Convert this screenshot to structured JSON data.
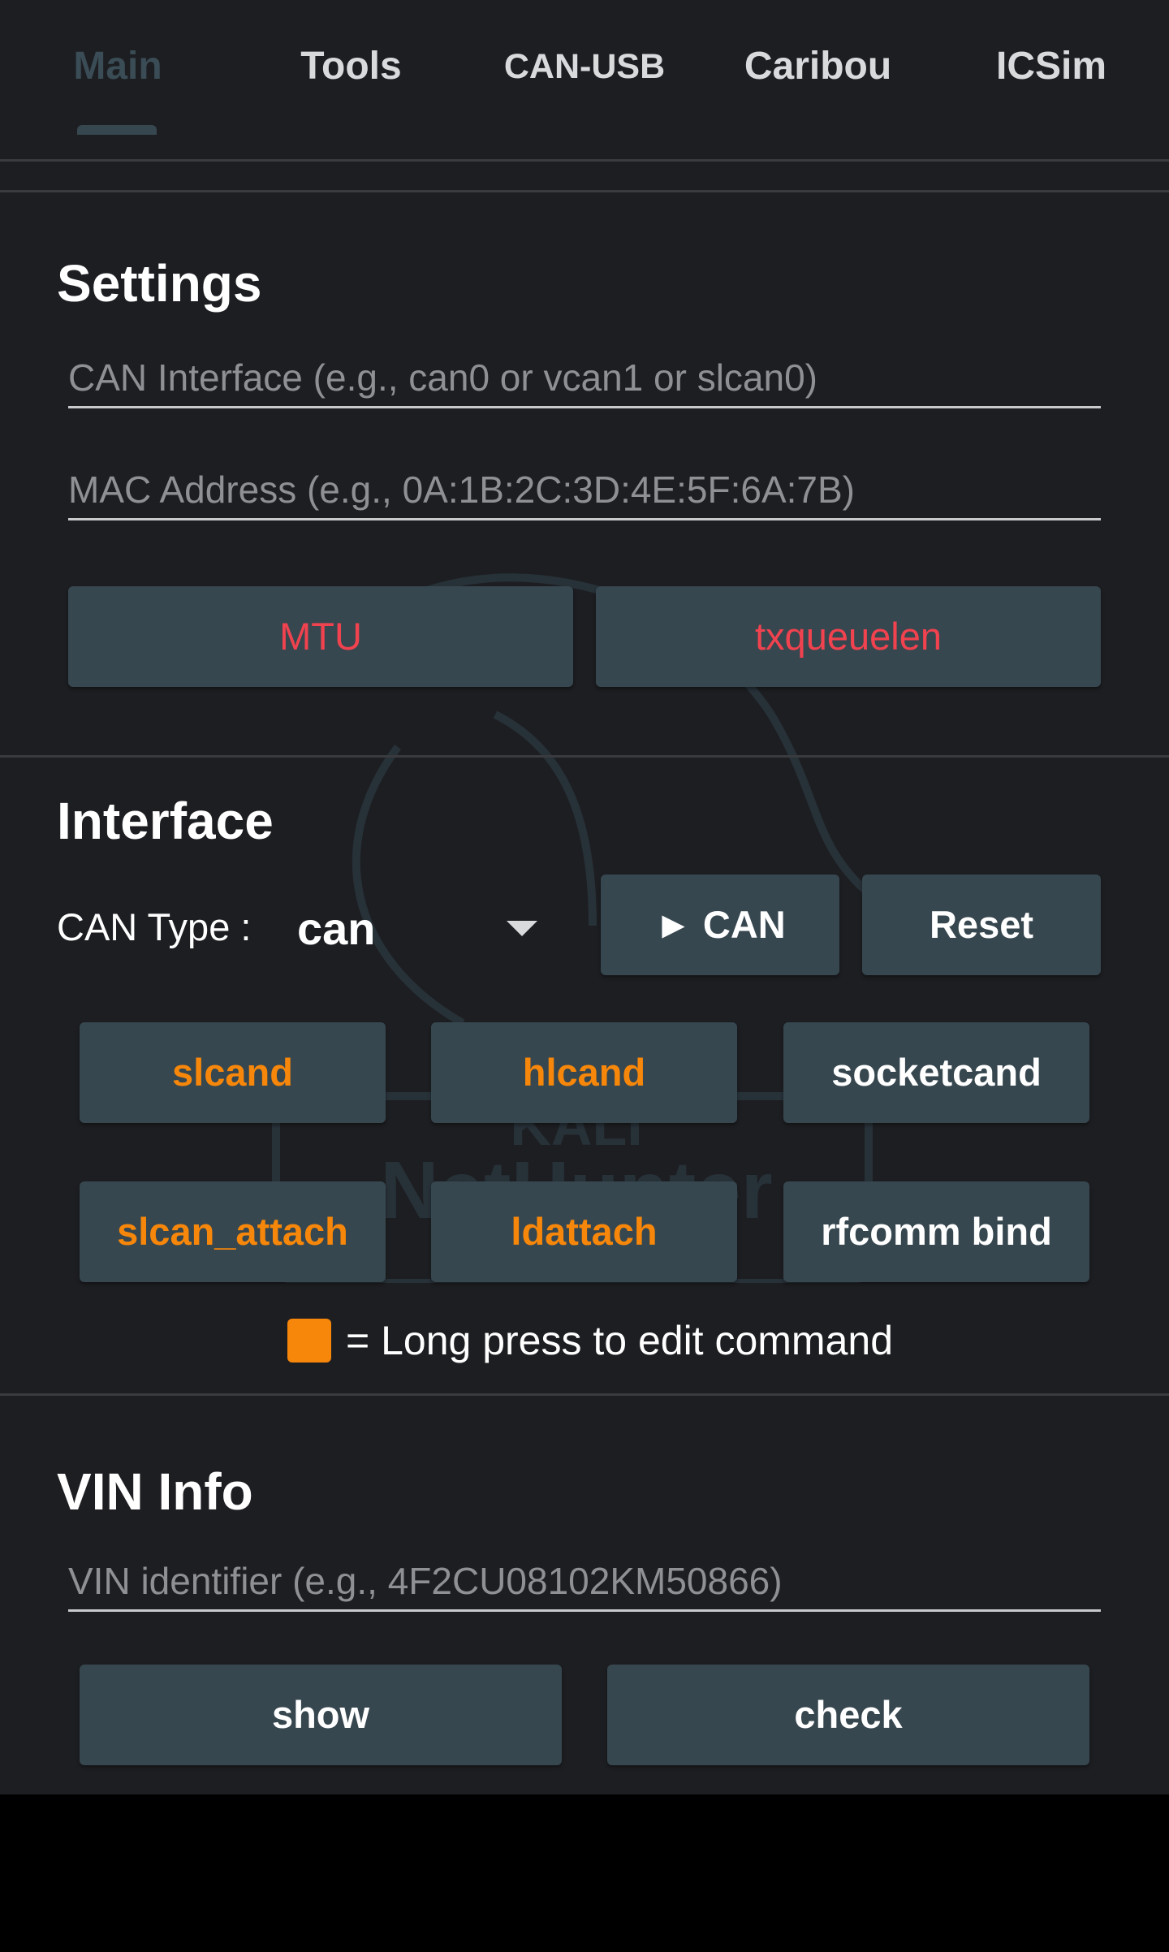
{
  "tabs": [
    {
      "label": "Main",
      "active": true
    },
    {
      "label": "Tools",
      "active": false
    },
    {
      "label": "CAN-USB",
      "active": false
    },
    {
      "label": "Caribou",
      "active": false
    },
    {
      "label": "ICSim",
      "active": false
    }
  ],
  "settings": {
    "title": "Settings",
    "can_interface_placeholder": "CAN Interface (e.g., can0 or vcan1 or slcan0)",
    "mac_address_placeholder": "MAC Address (e.g., 0A:1B:2C:3D:4E:5F:6A:7B)",
    "mtu_label": "MTU",
    "txqueuelen_label": "txqueuelen"
  },
  "interface": {
    "title": "Interface",
    "can_type_label": "CAN Type :",
    "can_type_value": "can",
    "start_can_label": "► CAN",
    "reset_label": "Reset",
    "slcand_label": "slcand",
    "hlcand_label": "hlcand",
    "socketcand_label": "socketcand",
    "slcan_attach_label": "slcan_attach",
    "ldattach_label": "ldattach",
    "rfcomm_bind_label": "rfcomm bind",
    "legend_text": "= Long press to edit command"
  },
  "vin_info": {
    "title": "VIN Info",
    "vin_placeholder": "VIN identifier (e.g., 4F2CU08102KM50866)",
    "show_label": "show",
    "check_label": "check"
  },
  "watermark": {
    "line1": "KALI",
    "line2": "NetHunter"
  },
  "colors": {
    "background": "#1d1e22",
    "button": "#37474f",
    "red_text": "#f0424f",
    "orange_text": "#f7870a"
  }
}
